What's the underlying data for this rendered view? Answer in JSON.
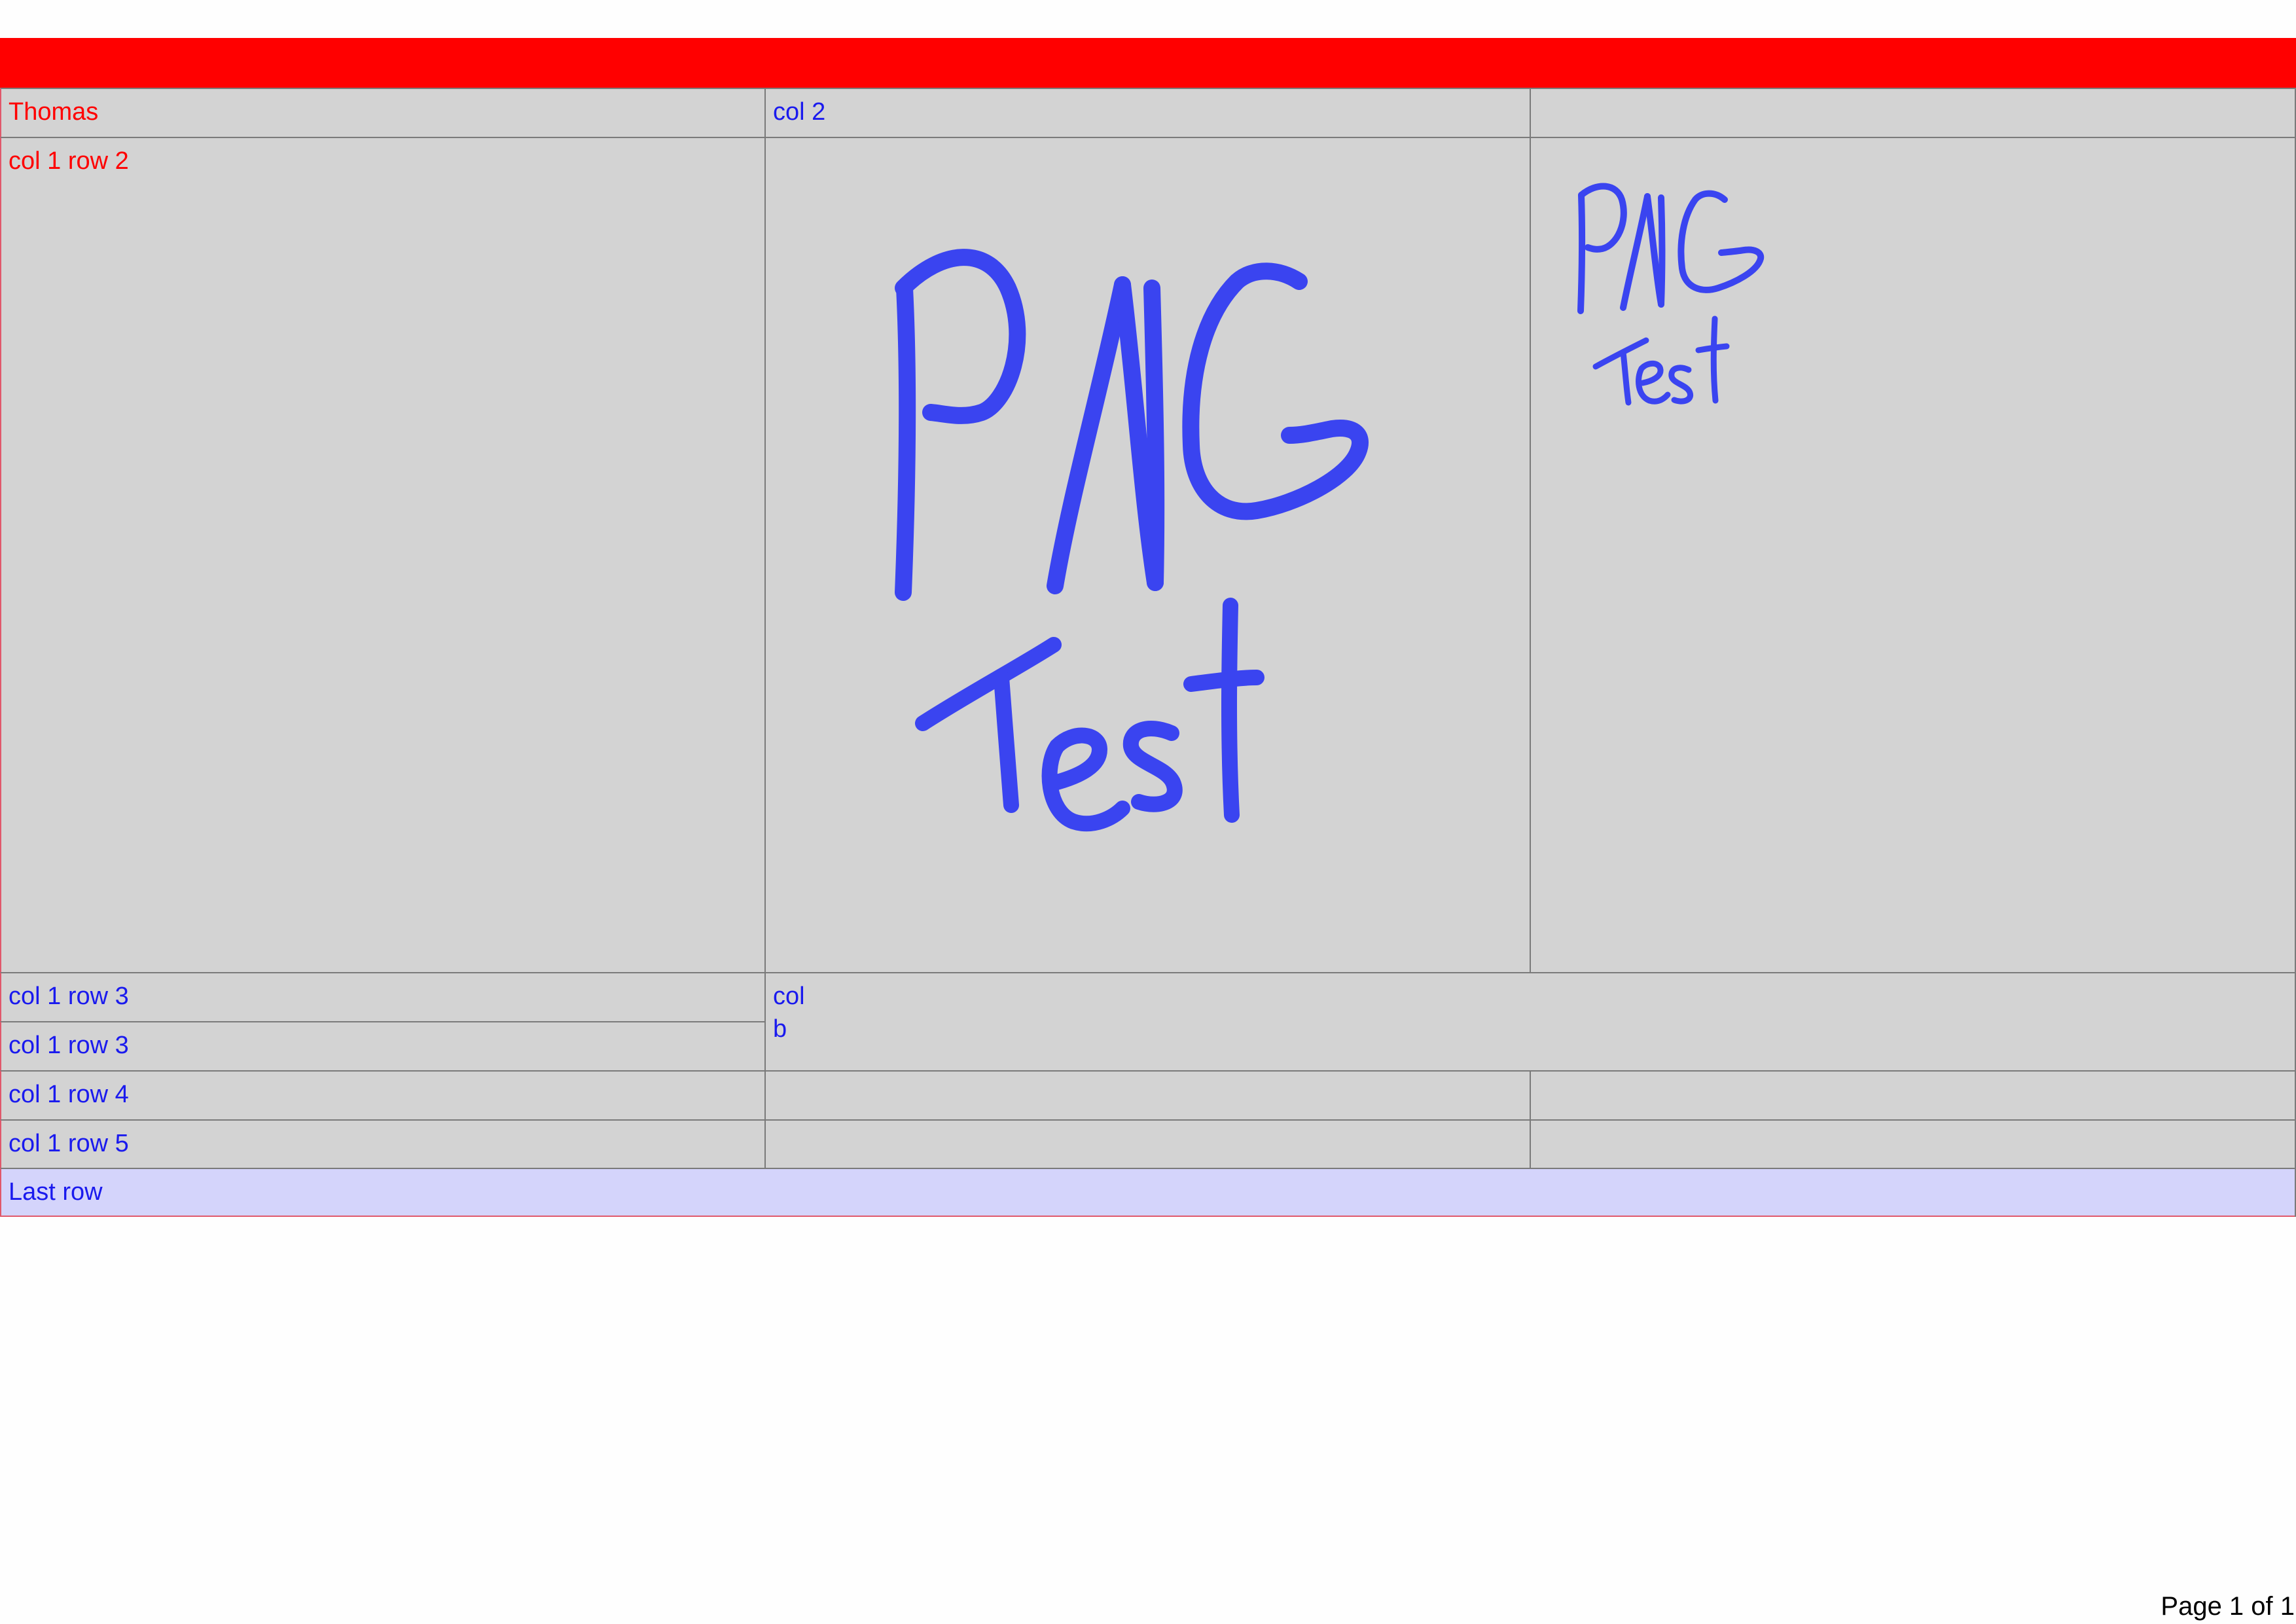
{
  "table": {
    "row1": {
      "col1": "Thomas",
      "col2": "col 2",
      "col3": ""
    },
    "row2": {
      "col1": "col 1 row 2",
      "image_text_large": [
        "PNG",
        "Test"
      ],
      "image_text_small": [
        "PNG",
        "Test"
      ]
    },
    "row3": {
      "col1a": "col 1 row 3",
      "col1b": "col 1 row 3",
      "col2_line1": "col",
      "col2_line2": "b"
    },
    "row4": {
      "col1": "col 1 row 4"
    },
    "row5": {
      "col1": "col 1 row 5"
    },
    "last_row": "Last row"
  },
  "footer": {
    "page_label": "Page 1 of 1"
  },
  "colors": {
    "header_bar": "#ff0000",
    "cell_background": "#d3d3d3",
    "last_row_background": "#d4d4fb",
    "text_blue": "#1a1aee",
    "text_red": "#ff0000",
    "ink_blue": "#3a44f0"
  }
}
